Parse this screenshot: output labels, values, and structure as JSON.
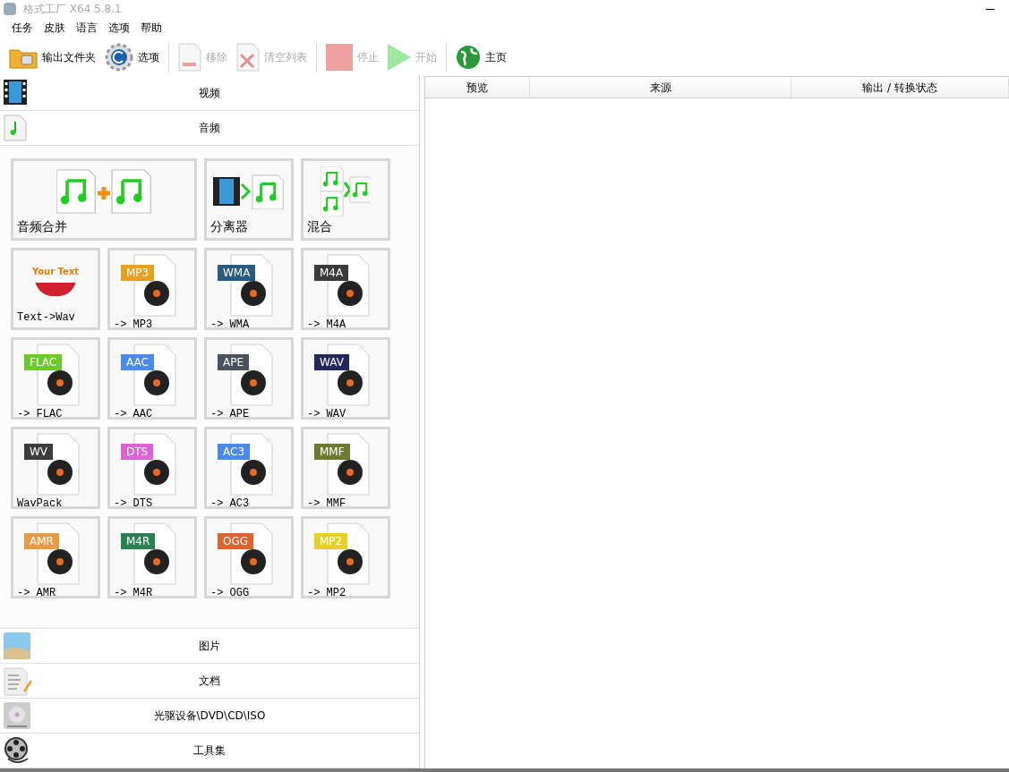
{
  "window": {
    "title": "格式工厂 X64 5.8.1"
  },
  "menu": [
    "任务",
    "皮肤",
    "语言",
    "选项",
    "帮助"
  ],
  "toolbar": [
    {
      "label": "输出文件夹",
      "kind": "folder",
      "disabled": false
    },
    {
      "label": "选项",
      "kind": "gear",
      "disabled": false
    },
    {
      "label": "移除",
      "kind": "remove",
      "disabled": true
    },
    {
      "label": "清空列表",
      "kind": "clear",
      "disabled": true
    },
    {
      "label": "停止",
      "kind": "stop",
      "disabled": true
    },
    {
      "label": "开始",
      "kind": "start",
      "disabled": true
    },
    {
      "label": "主页",
      "kind": "globe",
      "disabled": false
    }
  ],
  "categories": [
    {
      "label": "视频",
      "kind": "film",
      "expanded": false
    },
    {
      "label": "音频",
      "kind": "note",
      "expanded": true
    },
    {
      "label": "图片",
      "kind": "picture",
      "expanded": false
    },
    {
      "label": "文档",
      "kind": "document",
      "expanded": false
    },
    {
      "label": "光驱设备\\DVD\\CD\\ISO",
      "kind": "disc",
      "expanded": false
    },
    {
      "label": "工具集",
      "kind": "reel",
      "expanded": false
    }
  ],
  "tools": [
    {
      "label": "音频合并",
      "kind": "merge"
    },
    {
      "label": "分离器",
      "kind": "splitter"
    },
    {
      "label": "混合",
      "kind": "mix"
    },
    {
      "label": "Text->Wav",
      "kind": "text",
      "tag": "Your Text"
    },
    {
      "label": "-> MP3",
      "kind": "format",
      "tag": "MP3",
      "color": "#e8a020"
    },
    {
      "label": "-> WMA",
      "kind": "format",
      "tag": "WMA",
      "color": "#2a5a80"
    },
    {
      "label": "-> M4A",
      "kind": "format",
      "tag": "M4A",
      "color": "#3a3a3a"
    },
    {
      "label": "-> FLAC",
      "kind": "format",
      "tag": "FLAC",
      "color": "#6cc92a"
    },
    {
      "label": "-> AAC",
      "kind": "format",
      "tag": "AAC",
      "color": "#4a8af0"
    },
    {
      "label": "-> APE",
      "kind": "format",
      "tag": "APE",
      "color": "#4a5260"
    },
    {
      "label": "-> WAV",
      "kind": "format",
      "tag": "WAV",
      "color": "#22285a"
    },
    {
      "label": "WavPack",
      "kind": "format",
      "tag": "WV",
      "color": "#3c3c3c"
    },
    {
      "label": "-> DTS",
      "kind": "format",
      "tag": "DTS",
      "color": "#e060d8"
    },
    {
      "label": "-> AC3",
      "kind": "format",
      "tag": "AC3",
      "color": "#4a8af0"
    },
    {
      "label": "-> MMF",
      "kind": "format",
      "tag": "MMF",
      "color": "#6e7a30"
    },
    {
      "label": "-> AMR",
      "kind": "format",
      "tag": "AMR",
      "color": "#e89a40"
    },
    {
      "label": "-> M4R",
      "kind": "format",
      "tag": "M4R",
      "color": "#2a8050"
    },
    {
      "label": "-> OGG",
      "kind": "format",
      "tag": "OGG",
      "color": "#e06030"
    },
    {
      "label": "-> MP2",
      "kind": "format",
      "tag": "MP2",
      "color": "#e8d020"
    }
  ],
  "table": {
    "columns": [
      "预览",
      "来源",
      "输出 / 转换状态"
    ]
  }
}
